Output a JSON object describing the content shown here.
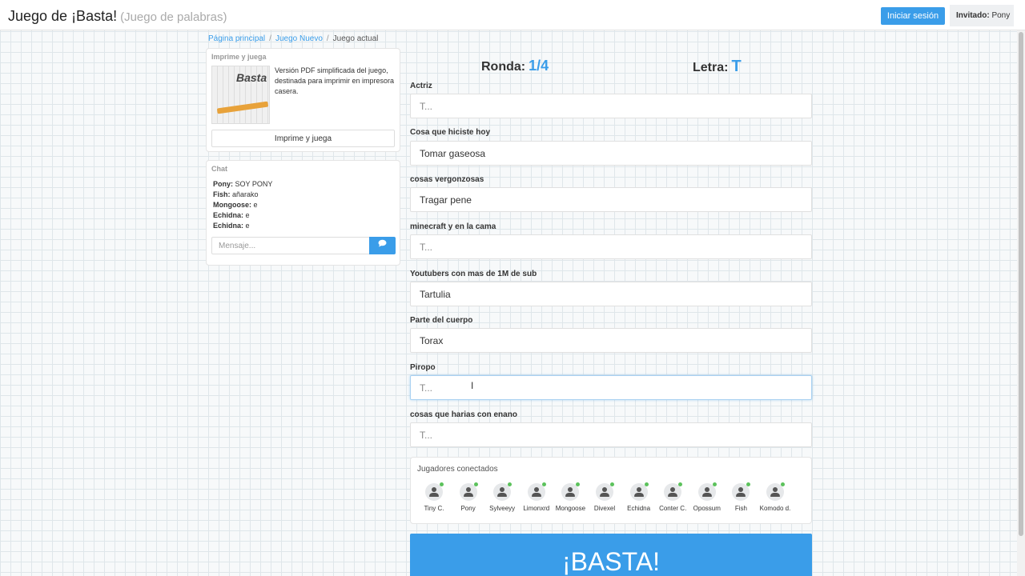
{
  "header": {
    "title": "Juego de ¡Basta!",
    "subtitle": "(Juego de palabras)",
    "login_label": "Iniciar sesión",
    "guest_label": "Invitado:",
    "guest_name": "Pony"
  },
  "breadcrumb": {
    "home": "Página principal",
    "new_game": "Juego Nuevo",
    "current": "Juego actual"
  },
  "print": {
    "title": "Imprime y juega",
    "logo_text": "Basta",
    "description": "Versión PDF simplificada del juego, destinada para imprimir en impresora casera.",
    "button": "Imprime y juega"
  },
  "chat": {
    "title": "Chat",
    "messages": [
      {
        "user": "Pony:",
        "text": "SOY PONY"
      },
      {
        "user": "Fish:",
        "text": "añarako"
      },
      {
        "user": "Mongoose:",
        "text": "e"
      },
      {
        "user": "Echidna:",
        "text": "e"
      },
      {
        "user": "Echidna:",
        "text": "e"
      }
    ],
    "placeholder": "Mensaje...",
    "send_icon": "comment-icon"
  },
  "game": {
    "round_label": "Ronda:",
    "round_value": "1/4",
    "letter_label": "Letra:",
    "letter_value": "T"
  },
  "fields": [
    {
      "label": "Actriz",
      "value": "",
      "placeholder": "T..."
    },
    {
      "label": "Cosa que hiciste hoy",
      "value": "Tomar gaseosa",
      "placeholder": "T..."
    },
    {
      "label": "cosas vergonzosas",
      "value": "Tragar pene",
      "placeholder": "T..."
    },
    {
      "label": "minecraft y en la cama",
      "value": "",
      "placeholder": "T..."
    },
    {
      "label": "Youtubers con mas de 1M de sub",
      "value": "Tartulia",
      "placeholder": "T..."
    },
    {
      "label": "Parte del cuerpo",
      "value": "Torax",
      "placeholder": "T..."
    },
    {
      "label": "Piropo",
      "value": "",
      "placeholder": "T..."
    },
    {
      "label": "cosas que harias con enano",
      "value": "",
      "placeholder": "T..."
    }
  ],
  "players": {
    "title": "Jugadores conectados",
    "list": [
      "Tiny C.",
      "Pony",
      "Sylveeyy",
      "Limonxrd",
      "Mongoose",
      "Divexel",
      "Echidna",
      "Conter C.",
      "Opossum",
      "Fish",
      "Komodo d."
    ],
    "online_color": "#5cc25c"
  },
  "basta_label": "¡BASTA!",
  "accent_color": "#3a9de9"
}
